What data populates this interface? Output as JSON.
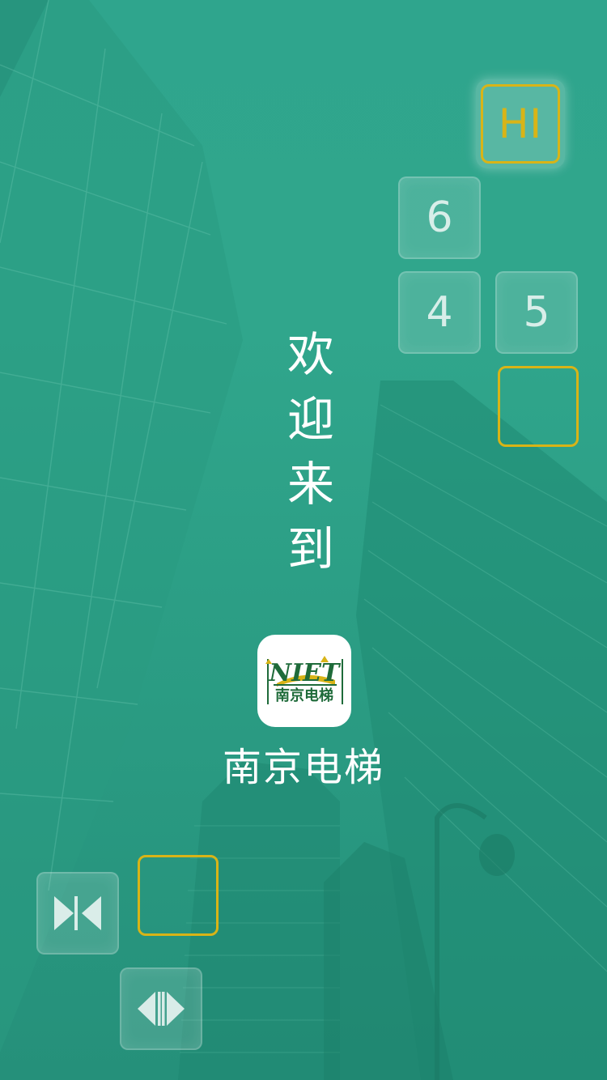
{
  "keypad": {
    "hi_label": "HI",
    "floor_6": "6",
    "floor_4": "4",
    "floor_5": "5"
  },
  "welcome": {
    "chars": [
      "欢",
      "迎",
      "来",
      "到"
    ]
  },
  "logo": {
    "latin": "NIET",
    "chinese": "南京电梯"
  },
  "app": {
    "name": "南京电梯"
  },
  "controls": {
    "close_door_icon": "door-close-icon",
    "open_door_icon": "door-open-icon"
  },
  "colors": {
    "background": "#2fa58d",
    "highlight": "#d8b417",
    "text": "#ffffff"
  }
}
